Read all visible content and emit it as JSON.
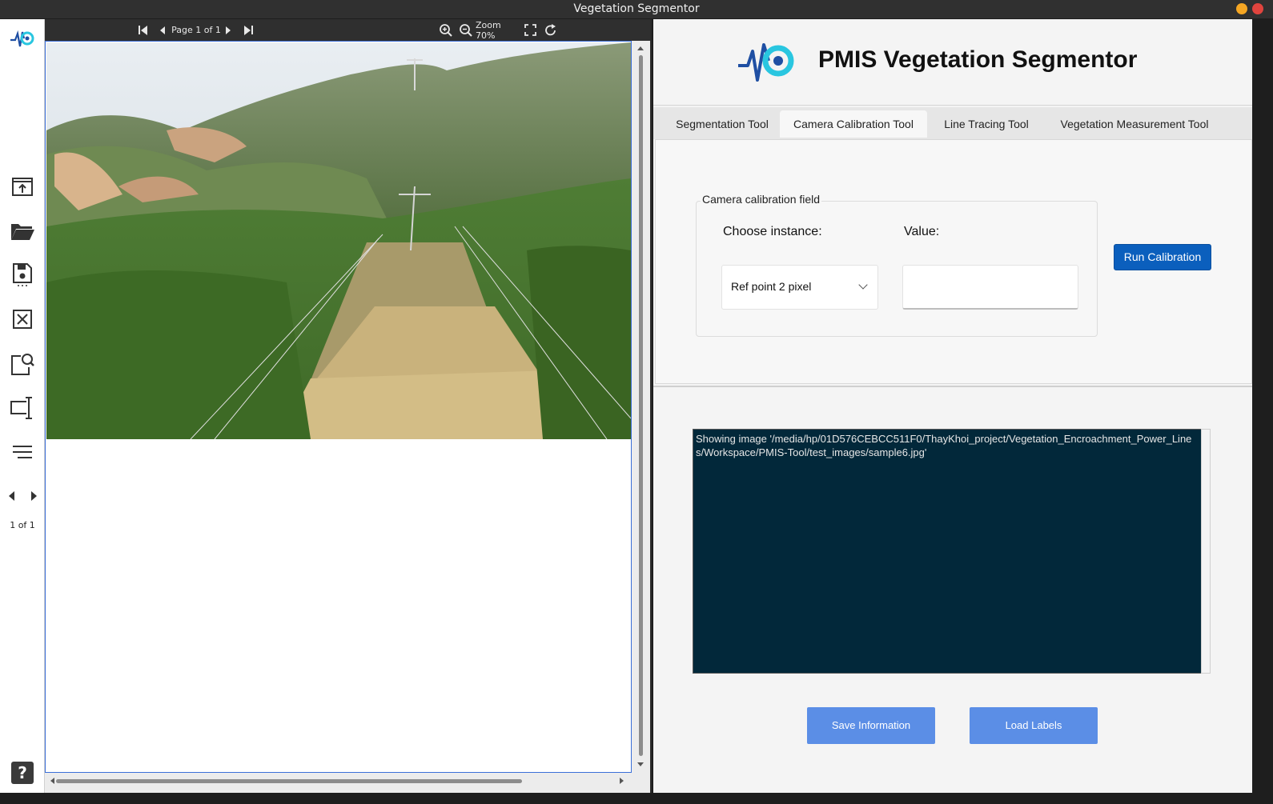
{
  "window": {
    "title": "Vegetation Segmentor"
  },
  "viewer_toolbar": {
    "page_label": "Page 1 of 1",
    "zoom_label": "Zoom 70%"
  },
  "rail": {
    "icons": [
      "upload-icon",
      "folder-open-icon",
      "save-icon",
      "close-icon",
      "zoom-region-icon",
      "text-cursor-icon",
      "align-lines-icon"
    ],
    "page_count": "1 of 1",
    "help": "?"
  },
  "header": {
    "title": "PMIS Vegetation Segmentor"
  },
  "tabs": [
    {
      "label": "Segmentation Tool",
      "active": false
    },
    {
      "label": "Camera Calibration Tool",
      "active": true
    },
    {
      "label": "Line Tracing Tool",
      "active": false
    },
    {
      "label": "Vegetation Measurement Tool",
      "active": false
    }
  ],
  "calibration": {
    "group_title": "Camera calibration field",
    "instance_label": "Choose instance:",
    "value_label": "Value:",
    "instance_selected": "Ref point 2 pixel",
    "value": "",
    "run_button": "Run Calibration"
  },
  "console": {
    "text": "Showing image '/media/hp/01D576CEBCC511F0/ThayKhoi_project/Vegetation_Encroachment_Power_Lines/Workspace/PMIS-Tool/test_images/sample6.jpg'"
  },
  "actions": {
    "save_label": "Save Information",
    "load_label": "Load Labels"
  },
  "colors": {
    "accent": "#0b5fbd",
    "action_button": "#5b8ee6",
    "console_bg": "#02283a",
    "logo_blue": "#1f4fa3",
    "logo_cyan": "#29c6e0"
  }
}
